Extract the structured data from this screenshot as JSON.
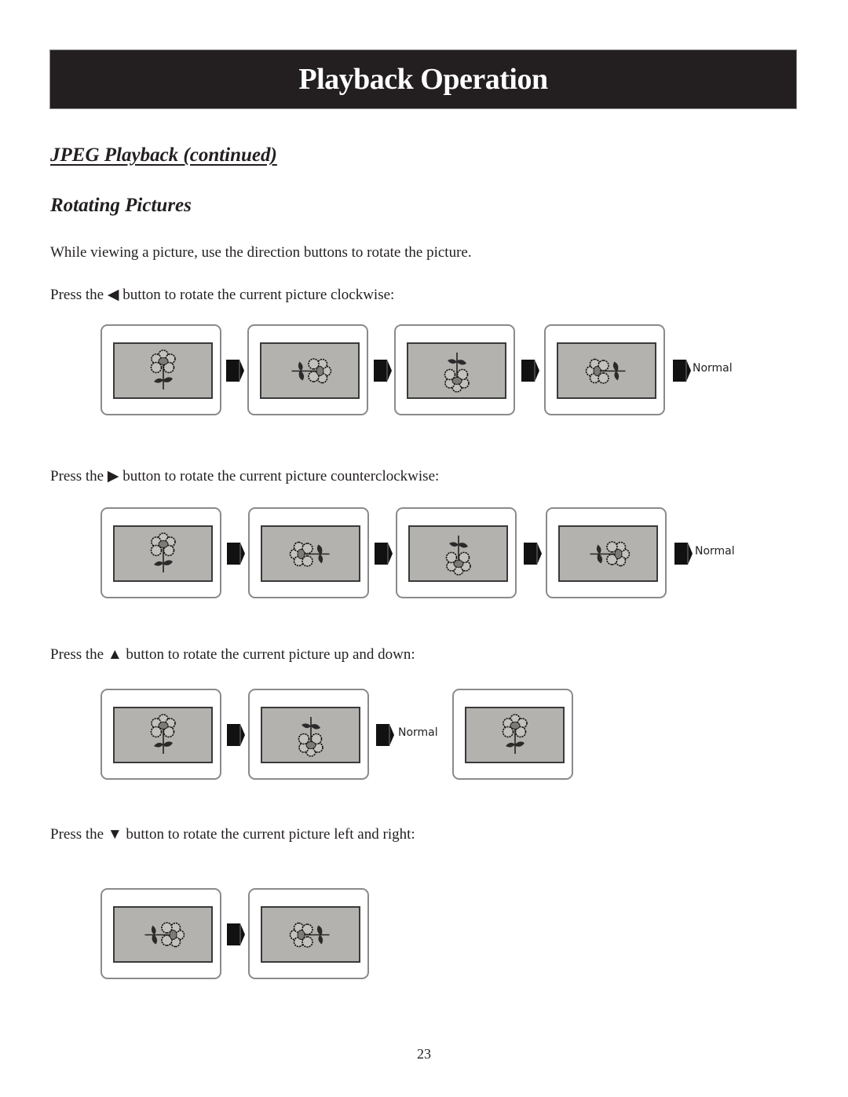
{
  "header": {
    "title": "Playback Operation"
  },
  "section": {
    "title": "JPEG Playback (continued)",
    "subtitle": "Rotating Pictures",
    "intro": "While viewing a picture, use the direction buttons to rotate the picture."
  },
  "rows": [
    {
      "prefix": "Press the",
      "button_icon": "left-triangle-icon",
      "button_glyph": "◀",
      "suffix": "button to rotate the current picture clockwise:",
      "frames": [
        "upright",
        "rotated-90-cw",
        "rotated-180",
        "rotated-270-cw"
      ],
      "end_label": "Normal"
    },
    {
      "prefix": "Press the",
      "button_icon": "right-triangle-icon",
      "button_glyph": "▶",
      "suffix": "button to rotate the current picture counterclockwise:",
      "frames": [
        "upright",
        "rotated-90-ccw",
        "rotated-180",
        "rotated-270-ccw"
      ],
      "end_label": "Normal"
    },
    {
      "prefix": "Press the",
      "button_icon": "up-triangle-icon",
      "button_glyph": "▲",
      "suffix": "button to rotate the current picture up and down:",
      "frames": [
        "upright",
        "flipped-vertical",
        "upright"
      ],
      "end_label": "Normal"
    },
    {
      "prefix": "Press the",
      "button_icon": "down-triangle-icon",
      "button_glyph": "▼",
      "suffix": "button to rotate the current picture left and right:",
      "frames": [
        "mirror-a",
        "mirror-b"
      ]
    }
  ],
  "footer": {
    "page_number": "23"
  }
}
